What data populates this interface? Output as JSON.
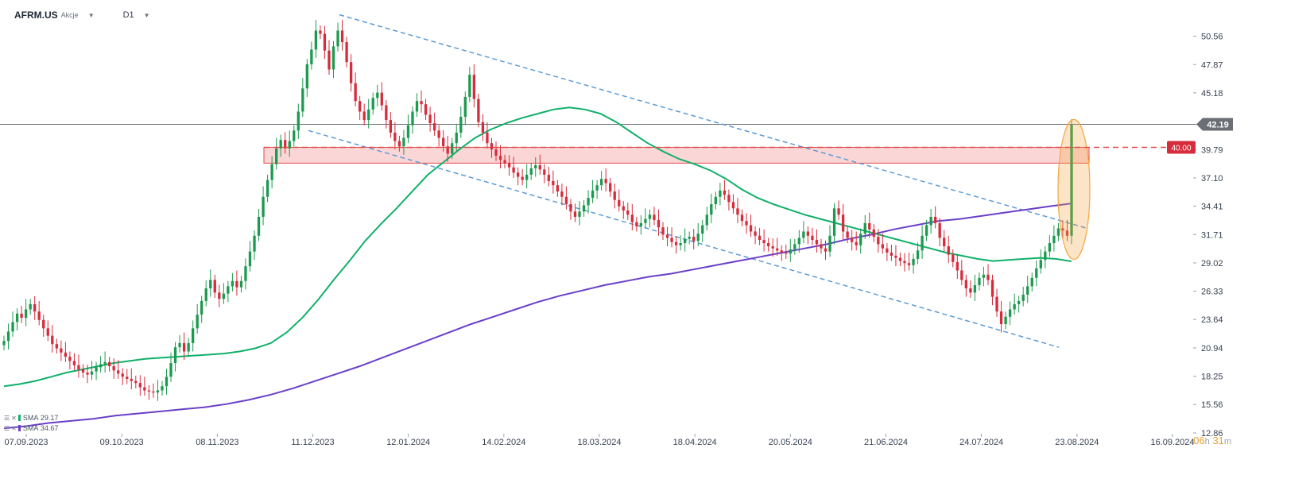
{
  "header": {
    "symbol": "AFRM.US",
    "type": "Akcje",
    "timeframe": "D1"
  },
  "countdown": {
    "hours": "06",
    "h_unit": "h",
    "minutes": "31",
    "m_unit": "m"
  },
  "legend": [
    {
      "label": "SMA",
      "value": "29.17",
      "color": "#10b06a"
    },
    {
      "label": "SMA",
      "value": "34.67",
      "color": "#6a3fc8"
    }
  ],
  "chart_data": {
    "type": "candlestick",
    "colors": {
      "up": "#1c9a4f",
      "down": "#d62c3c",
      "sma_fast": "#10b06a",
      "sma_slow": "#6a3fc8",
      "channel": "#5b9bd5",
      "resistance": "#e34b4b",
      "highlight": "#f5a742",
      "price_line": "#6b6f75"
    },
    "ylim": [
      12.86,
      53.25
    ],
    "y_ticks": [
      50.56,
      47.87,
      45.18,
      39.79,
      37.1,
      34.41,
      31.71,
      29.02,
      26.33,
      23.64,
      20.94,
      18.25,
      15.56,
      12.86
    ],
    "x_ticks": [
      "07.09.2023",
      "09.10.2023",
      "08.11.2023",
      "11.12.2023",
      "12.01.2024",
      "14.02.2024",
      "18.03.2024",
      "18.04.2024",
      "20.05.2024",
      "21.06.2024",
      "24.07.2024",
      "23.08.2024",
      "16.09.2024"
    ],
    "current_price": 42.19,
    "resistance": {
      "level": 40.0,
      "label": "40.00",
      "zone": [
        38.5,
        40.0
      ]
    },
    "closes": [
      21.6,
      22.5,
      23.4,
      24.2,
      23.8,
      24.6,
      25.1,
      24.4,
      23.6,
      22.8,
      22.1,
      21.3,
      20.9,
      20.5,
      20.1,
      19.7,
      19.3,
      18.9,
      18.6,
      18.4,
      18.7,
      19.1,
      19.4,
      19.6,
      19.2,
      18.8,
      18.5,
      18.2,
      18.0,
      17.8,
      17.6,
      17.2,
      16.9,
      16.8,
      16.7,
      16.9,
      17.3,
      18.2,
      19.5,
      21.0,
      21.4,
      20.6,
      21.4,
      22.8,
      24.1,
      25.4,
      26.6,
      27.4,
      26.2,
      25.6,
      26.1,
      26.8,
      27.3,
      26.7,
      27.3,
      28.7,
      30.1,
      31.6,
      33.4,
      35.3,
      36.9,
      38.4,
      39.9,
      40.7,
      39.9,
      40.6,
      41.6,
      43.4,
      45.6,
      47.9,
      49.3,
      51.1,
      50.8,
      49.2,
      47.4,
      49.6,
      51.1,
      50.0,
      48.1,
      46.1,
      44.4,
      43.4,
      42.6,
      43.6,
      44.7,
      45.2,
      44.0,
      42.6,
      41.4,
      40.6,
      40.1,
      40.9,
      42.1,
      43.4,
      44.4,
      44.1,
      43.1,
      42.3,
      41.6,
      40.9,
      40.1,
      39.4,
      40.4,
      41.4,
      42.9,
      44.8,
      46.9,
      44.6,
      42.4,
      41.4,
      40.4,
      39.8,
      39.2,
      38.8,
      38.5,
      38.1,
      37.6,
      37.2,
      36.9,
      37.4,
      38.0,
      38.3,
      37.9,
      37.4,
      36.8,
      36.4,
      35.8,
      35.3,
      34.6,
      33.9,
      33.4,
      33.9,
      34.5,
      35.2,
      35.9,
      36.4,
      37.0,
      36.6,
      35.8,
      35.0,
      34.4,
      34.0,
      33.6,
      32.9,
      32.5,
      32.8,
      33.2,
      33.6,
      33.1,
      32.4,
      31.7,
      31.4,
      31.0,
      30.7,
      30.9,
      31.3,
      31.5,
      31.1,
      31.8,
      32.6,
      33.6,
      34.6,
      35.3,
      35.9,
      35.5,
      34.8,
      34.2,
      33.6,
      33.0,
      32.6,
      32.0,
      31.6,
      31.2,
      30.9,
      30.6,
      30.4,
      30.2,
      30.0,
      29.9,
      30.3,
      30.8,
      31.4,
      32.0,
      31.6,
      31.2,
      30.8,
      30.4,
      30.1,
      31.6,
      34.2,
      33.6,
      32.0,
      31.4,
      31.0,
      30.7,
      31.8,
      32.8,
      32.2,
      31.5,
      30.8,
      30.4,
      30.0,
      29.7,
      29.5,
      29.2,
      29.0,
      28.8,
      29.4,
      30.2,
      31.6,
      32.6,
      33.4,
      32.8,
      31.4,
      30.6,
      29.8,
      29.1,
      28.3,
      27.4,
      26.6,
      26.2,
      26.9,
      27.6,
      27.9,
      27.4,
      25.8,
      24.4,
      23.2,
      23.9,
      24.6,
      25.1,
      25.4,
      26.0,
      26.8,
      27.6,
      28.5,
      29.3,
      30.1,
      30.9,
      31.6,
      32.3,
      32.1,
      31.6,
      42.19
    ],
    "sma_fast": [
      17.3,
      17.5,
      17.8,
      18.2,
      18.6,
      18.9,
      19.2,
      19.5,
      19.7,
      19.9,
      20.0,
      20.1,
      20.2,
      20.3,
      20.4,
      20.6,
      20.9,
      21.4,
      22.4,
      23.8,
      25.5,
      27.4,
      29.2,
      31.1,
      32.7,
      34.2,
      35.8,
      37.4,
      38.6,
      39.8,
      40.9,
      41.7,
      42.3,
      42.8,
      43.2,
      43.6,
      43.8,
      43.6,
      43.2,
      42.4,
      41.4,
      40.4,
      39.6,
      38.9,
      38.4,
      37.8,
      37.0,
      36.0,
      35.2,
      34.6,
      34.1,
      33.6,
      33.2,
      32.8,
      32.4,
      32.0,
      31.6,
      31.2,
      30.8,
      30.4,
      30.0,
      29.7,
      29.4,
      29.2,
      29.3,
      29.4,
      29.5,
      29.4,
      29.17
    ],
    "sma_slow": [
      13.3,
      13.5,
      13.8,
      14.0,
      14.2,
      14.5,
      14.7,
      14.9,
      15.1,
      15.3,
      15.6,
      16.0,
      16.5,
      17.1,
      17.8,
      18.5,
      19.2,
      20.0,
      20.8,
      21.6,
      22.4,
      23.2,
      23.9,
      24.6,
      25.3,
      25.9,
      26.4,
      26.9,
      27.3,
      27.7,
      28.0,
      28.4,
      28.8,
      29.2,
      29.6,
      30.0,
      30.4,
      30.8,
      31.3,
      31.7,
      32.2,
      32.6,
      33.0,
      33.2,
      33.5,
      33.8,
      34.1,
      34.4,
      34.67
    ]
  }
}
